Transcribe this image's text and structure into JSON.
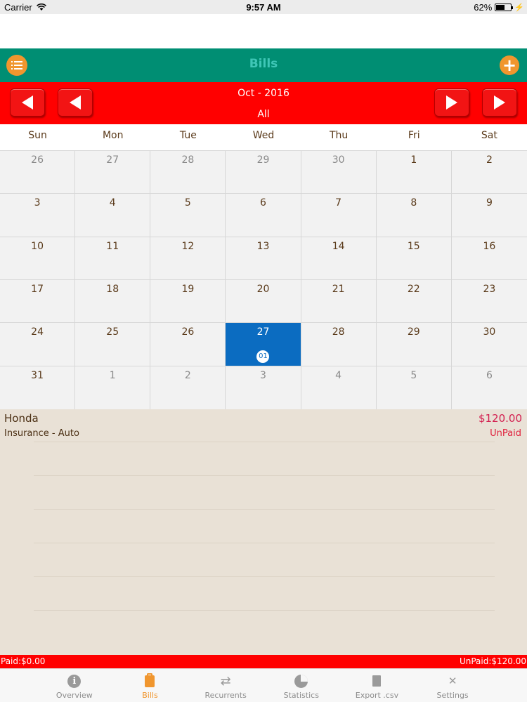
{
  "status_bar": {
    "carrier": "Carrier",
    "time": "9:57 AM",
    "battery": "62%",
    "battery_level": 0.62
  },
  "header": {
    "title": "Bills"
  },
  "nav": {
    "month": "Oct - 2016",
    "filter": "All"
  },
  "calendar": {
    "weekdays": [
      "Sun",
      "Mon",
      "Tue",
      "Wed",
      "Thu",
      "Fri",
      "Sat"
    ],
    "selected_day": "27",
    "selected_badge": "01",
    "weeks": [
      [
        "26",
        "27",
        "28",
        "29",
        "30",
        "1",
        "2"
      ],
      [
        "3",
        "4",
        "5",
        "6",
        "7",
        "8",
        "9"
      ],
      [
        "10",
        "11",
        "12",
        "13",
        "14",
        "15",
        "16"
      ],
      [
        "17",
        "18",
        "19",
        "20",
        "21",
        "22",
        "23"
      ],
      [
        "24",
        "25",
        "26",
        "27",
        "28",
        "29",
        "30"
      ],
      [
        "31",
        "1",
        "2",
        "3",
        "4",
        "5",
        "6"
      ]
    ]
  },
  "bills": [
    {
      "name": "Honda",
      "category": "Insurance - Auto",
      "amount": "$120.00",
      "status": "UnPaid"
    }
  ],
  "summary": {
    "paid": "Paid:$0.00",
    "unpaid": "UnPaid:$120.00"
  },
  "tabs": [
    {
      "label": "Overview",
      "icon": "info-icon"
    },
    {
      "label": "Bills",
      "icon": "bills-icon"
    },
    {
      "label": "Recurrents",
      "icon": "repeat-icon"
    },
    {
      "label": "Statistics",
      "icon": "pie-chart-icon"
    },
    {
      "label": "Export .csv",
      "icon": "document-icon"
    },
    {
      "label": "Settings",
      "icon": "tools-icon"
    }
  ],
  "colors": {
    "header_green": "#008e73",
    "nav_red": "#ff0000",
    "accent_orange": "#f0962e",
    "selected_blue": "#0b6cc1",
    "list_background": "#e9e1d6"
  }
}
